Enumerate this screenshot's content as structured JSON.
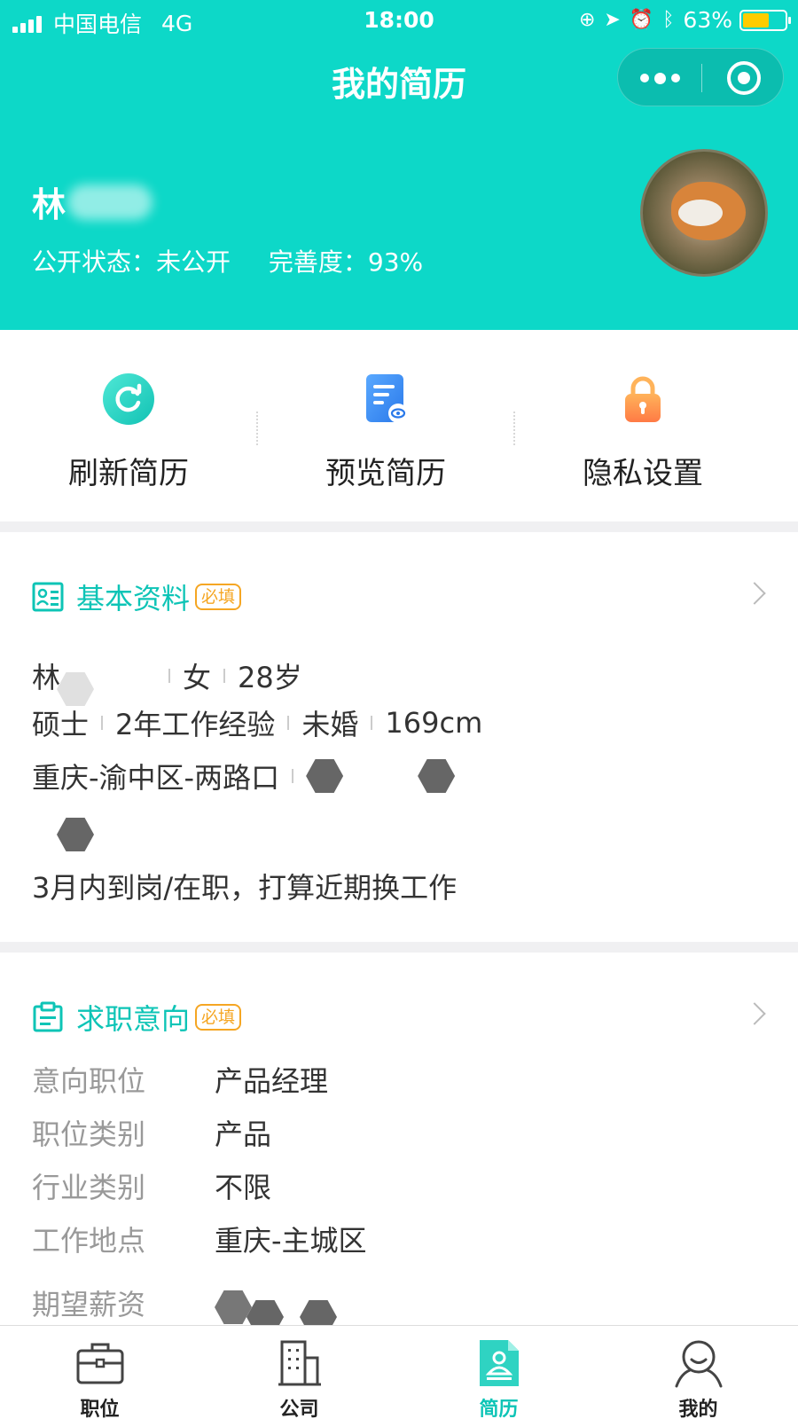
{
  "status_bar": {
    "carrier": "中国电信",
    "network": "4G",
    "time": "18:00",
    "battery": "63%",
    "battery_level": 0.63,
    "battery_color": "#ffcc00"
  },
  "header": {
    "title": "我的简历",
    "name_prefix": "林",
    "public_status": "公开状态：未公开",
    "completeness": "完善度：93%",
    "bg_color": "#0dd8c8"
  },
  "actions": [
    {
      "label": "刷新简历",
      "icon": "refresh-icon"
    },
    {
      "label": "预览简历",
      "icon": "preview-doc-icon"
    },
    {
      "label": "隐私设置",
      "icon": "lock-icon"
    }
  ],
  "basic_info": {
    "title": "基本资料",
    "badge": "必填",
    "name_prefix": "林",
    "gender": "女",
    "age": "28岁",
    "degree": "硕士",
    "experience": "2年工作经验",
    "marital": "未婚",
    "height": "169cm",
    "location": "重庆-渝中区-两路口",
    "availability": "3月内到岗/在职，打算近期换工作"
  },
  "job_intent": {
    "title": "求职意向",
    "badge": "必填",
    "rows": [
      {
        "key": "意向职位",
        "value": "产品经理"
      },
      {
        "key": "职位类别",
        "value": "产品"
      },
      {
        "key": "行业类别",
        "value": "不限"
      },
      {
        "key": "工作地点",
        "value": "重庆-主城区"
      },
      {
        "key": "期望薪资",
        "value": ""
      }
    ]
  },
  "tabbar": {
    "active": "简历",
    "accent": "#0dc4b6",
    "tabs": [
      {
        "label": "职位",
        "icon": "briefcase-icon"
      },
      {
        "label": "公司",
        "icon": "building-icon"
      },
      {
        "label": "简历",
        "icon": "resume-icon"
      },
      {
        "label": "我的",
        "icon": "user-icon"
      }
    ]
  }
}
